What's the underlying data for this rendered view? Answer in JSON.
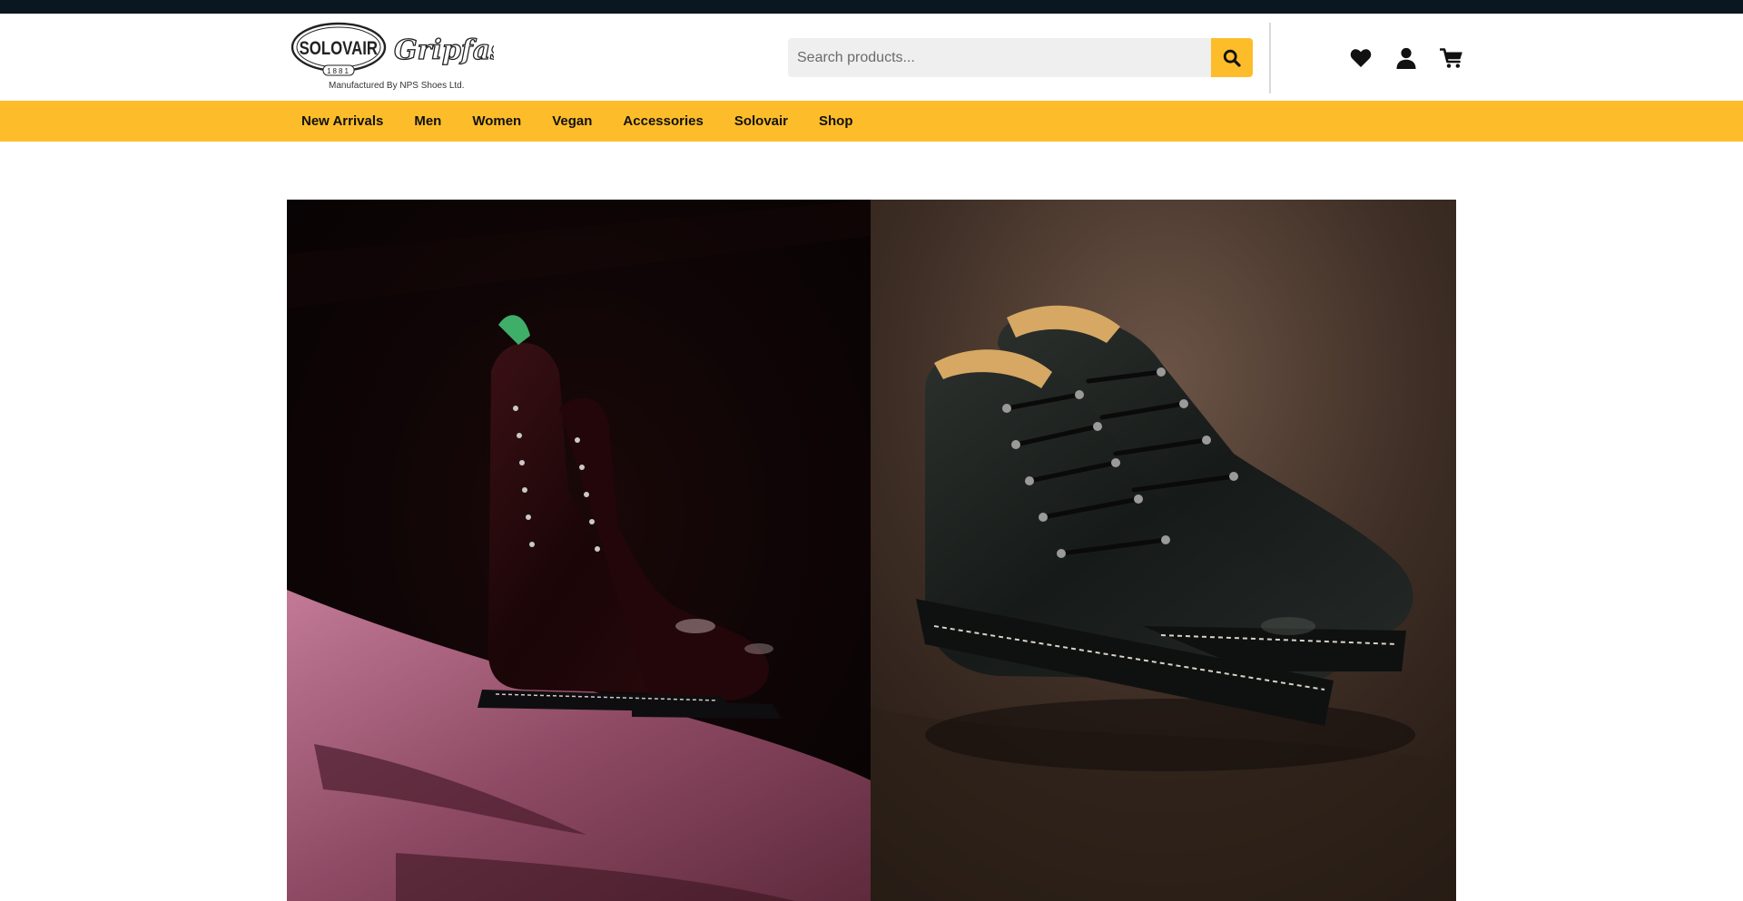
{
  "brand": {
    "logo_primary": "SOLOVAIR",
    "logo_year": "1881",
    "logo_secondary": "Gripfast",
    "tagline": "Manufactured By NPS Shoes Ltd."
  },
  "search": {
    "placeholder": "Search products...",
    "value": "",
    "button_icon": "search-icon"
  },
  "header_icons": [
    {
      "name": "wishlist",
      "icon": "heart-icon"
    },
    {
      "name": "account",
      "icon": "user-icon"
    },
    {
      "name": "cart",
      "icon": "cart-icon"
    }
  ],
  "nav": {
    "items": [
      {
        "label": "New Arrivals"
      },
      {
        "label": "Men"
      },
      {
        "label": "Women"
      },
      {
        "label": "Vegan"
      },
      {
        "label": "Accessories"
      },
      {
        "label": "Solovair"
      },
      {
        "label": "Shop"
      }
    ]
  },
  "hero": {
    "left_image": "oxblood-derby-boots-photo",
    "right_image": "black-hiking-boots-photo"
  },
  "colors": {
    "topbar": "#0a1620",
    "accent": "#fdbd2a",
    "search_bg": "#efefef"
  }
}
